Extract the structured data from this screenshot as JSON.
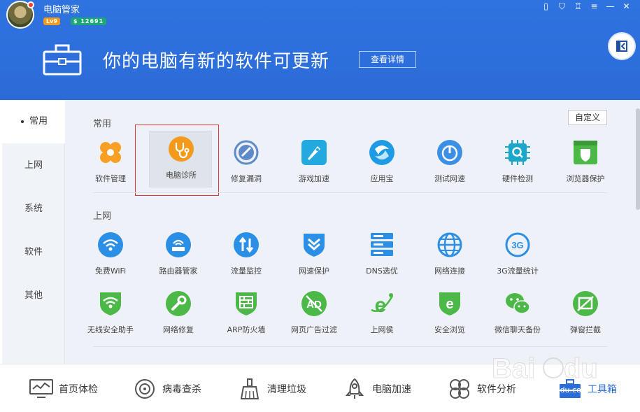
{
  "app": {
    "name": "电脑管家",
    "level": "Lv9",
    "coins": "$ 12691"
  },
  "banner": {
    "message": "你的电脑有新的软件可更新",
    "details_button": "查看详情"
  },
  "window_controls": [
    "phone-icon",
    "shield-icon",
    "shirt-icon",
    "menu-icon",
    "minimize-icon",
    "close-icon"
  ],
  "nav": {
    "items": [
      {
        "label": "常用",
        "active": true
      },
      {
        "label": "上网",
        "active": false
      },
      {
        "label": "系统",
        "active": false
      },
      {
        "label": "软件",
        "active": false
      },
      {
        "label": "其他",
        "active": false
      }
    ]
  },
  "customize_button": "自定义",
  "sections": {
    "common": {
      "title": "常用",
      "tools": [
        {
          "label": "软件管理",
          "icon": "clover-icon",
          "color": "#f7a024"
        },
        {
          "label": "电脑诊所",
          "icon": "stethoscope-icon",
          "color": "#f39a1c"
        },
        {
          "label": "修复漏洞",
          "icon": "patch-globe-icon",
          "color": "#5d8ac9"
        },
        {
          "label": "游戏加速",
          "icon": "rocket-game-icon",
          "color": "#22a9e0"
        },
        {
          "label": "应用宝",
          "icon": "yingyongbao-icon",
          "color": "#1f9be6"
        },
        {
          "label": "测试网速",
          "icon": "speedometer-icon",
          "color": "#3b8fe4"
        },
        {
          "label": "硬件检测",
          "icon": "chip-search-icon",
          "color": "#1aa7c9"
        },
        {
          "label": "浏览器保护",
          "icon": "browser-shield-icon",
          "color": "#4cb848"
        }
      ]
    },
    "internet": {
      "title": "上网",
      "tools_row1": [
        {
          "label": "免费WiFi",
          "icon": "free-wifi-icon",
          "color": "#2c8fe6"
        },
        {
          "label": "路由器管家",
          "icon": "router-icon",
          "color": "#2c8fe6"
        },
        {
          "label": "流量监控",
          "icon": "traffic-arrows-icon",
          "color": "#2c8fe6"
        },
        {
          "label": "网速保护",
          "icon": "speed-shield-icon",
          "color": "#2c8fe6"
        },
        {
          "label": "DNS选优",
          "icon": "dns-server-icon",
          "color": "#2c8fe6"
        },
        {
          "label": "网络连接",
          "icon": "globe-icon",
          "color": "#2c8fe6"
        },
        {
          "label": "3G流量统计",
          "icon": "3g-icon",
          "color": "#2c8fe6"
        }
      ],
      "tools_row2": [
        {
          "label": "无线安全助手",
          "icon": "wifi-shield-icon",
          "color": "#4cb848"
        },
        {
          "label": "网络修复",
          "icon": "wrench-icon",
          "color": "#4cb848"
        },
        {
          "label": "ARP防火墙",
          "icon": "firewall-shield-icon",
          "color": "#4cb848"
        },
        {
          "label": "网页广告过滤",
          "icon": "ad-block-icon",
          "color": "#4cb848"
        },
        {
          "label": "上网侯",
          "icon": "ie-bug-icon",
          "color": "#4cb848"
        },
        {
          "label": "安全浏览",
          "icon": "safe-browse-icon",
          "color": "#4cb848"
        },
        {
          "label": "微信聊天备份",
          "icon": "wechat-icon",
          "color": "#4cb848"
        },
        {
          "label": "弹窗拦截",
          "icon": "popup-block-icon",
          "color": "#4cb848"
        }
      ]
    }
  },
  "bottom_bar": [
    {
      "label": "首页体检",
      "icon": "monitor-chart-icon",
      "active": false
    },
    {
      "label": "病毒查杀",
      "icon": "virus-scan-icon",
      "active": false
    },
    {
      "label": "清理垃圾",
      "icon": "broom-icon",
      "active": false
    },
    {
      "label": "电脑加速",
      "icon": "rocket-icon",
      "active": false
    },
    {
      "label": "软件分析",
      "icon": "clover-outline-icon",
      "active": false
    },
    {
      "label": "工具箱",
      "icon": "toolbox-icon",
      "active": true
    }
  ],
  "watermark": {
    "text": "jingyan.baidu.com"
  }
}
